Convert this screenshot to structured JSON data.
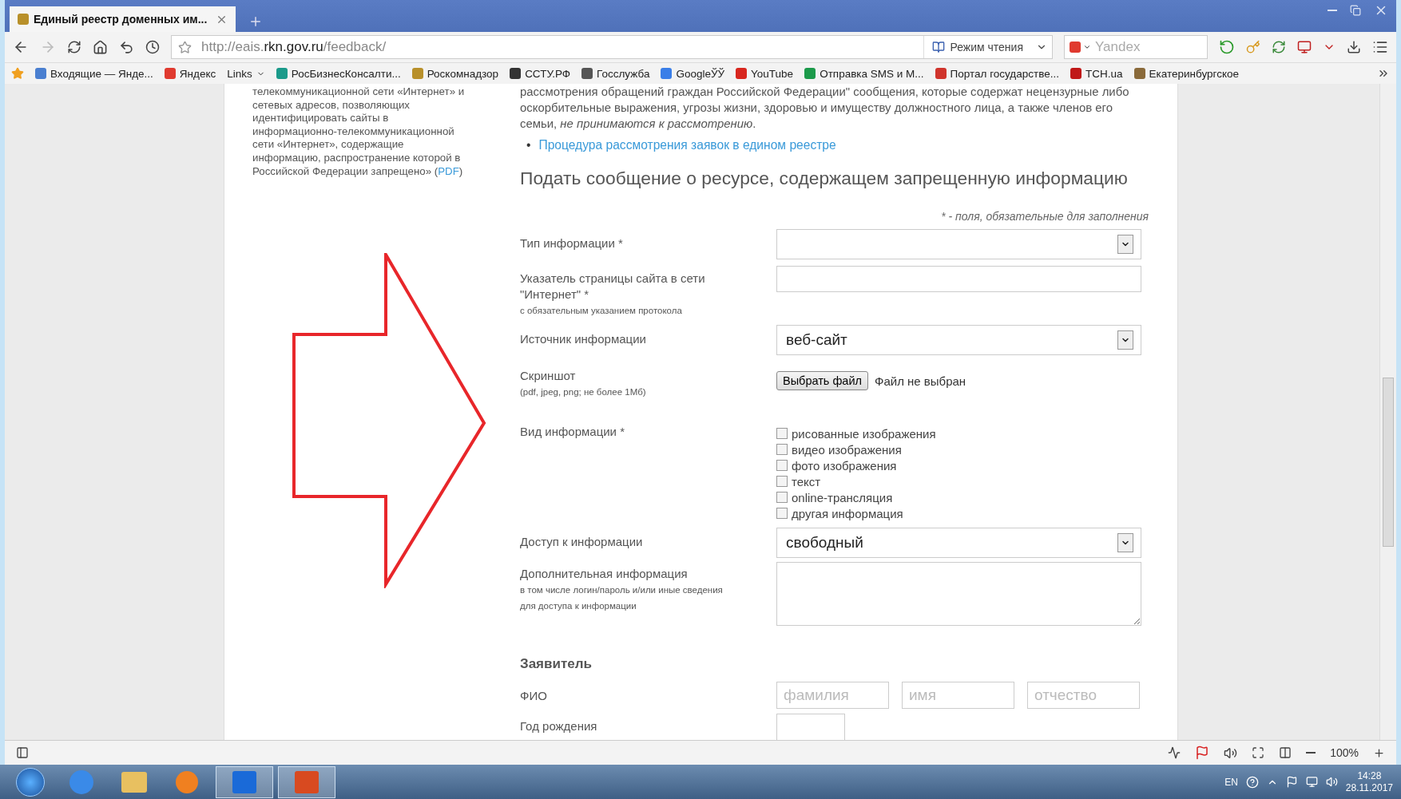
{
  "browser": {
    "tab_title": "Единый реестр доменных им...",
    "url_host_prefix": "http://eais.",
    "url_host": "rkn.gov.ru",
    "url_path": "/feedback/",
    "reader_mode": "Режим чтения",
    "search_placeholder": "Yandex",
    "bookmarks": [
      {
        "label": "Входящие — Янде...",
        "color": "#4a7fd0"
      },
      {
        "label": "Яндекс",
        "color": "#e03a2f"
      },
      {
        "label": "Links"
      },
      {
        "label": "РосБизнесКонсалти...",
        "color": "#1a9a8a"
      },
      {
        "label": "Роскомнадзор",
        "color": "#b8902a"
      },
      {
        "label": "ССТУ.РФ",
        "color": "#333333"
      },
      {
        "label": "Госслужба",
        "color": "#555555"
      },
      {
        "label": "GoogleЎЎ",
        "color": "#3a7ee8"
      },
      {
        "label": "YouTube",
        "color": "#d8261e"
      },
      {
        "label": "Отправка SMS и М...",
        "color": "#1b9a4a"
      },
      {
        "label": "Портал государстве...",
        "color": "#d0342c"
      },
      {
        "label": "TCH.ua",
        "color": "#c01818"
      },
      {
        "label": "Екатеринбургское",
        "color": "#8a6a3a"
      }
    ],
    "zoom": "100%"
  },
  "page": {
    "sidebar_text": "телекоммуникационной сети «Интернет» и сетевых адресов, позволяющих идентифицировать сайты в информационно-телекоммуникационной сети «Интернет», содержащие информацию, распространение которой в Российской Федерации запрещено» (",
    "sidebar_link": "PDF",
    "sidebar_tail": ")",
    "intro": "рассмотрения обращений граждан Российской Федерации\" сообщения, которые содержат нецензурные либо оскорбительные выражения, угрозы жизни, здоровью и имуществу должностного лица, а также членов его семьи, *не принимаются к рассмотрению*.",
    "bullet": "•",
    "link": "Процедура рассмотрения заявок в едином реестре",
    "heading": "Подать сообщение о ресурсе, содержащем запрещенную информацию",
    "required_note": "* - поля, обязательные для заполнения",
    "fields": [
      {
        "kind": "select",
        "label": "Тип информации *"
      },
      {
        "kind": "text",
        "label": "Указатель страницы сайта в сети \"Интернет\" *",
        "hint": "с обязательным указанием протокола"
      },
      {
        "kind": "select",
        "label": "Источник информации",
        "value": "веб-сайт"
      },
      {
        "kind": "file",
        "label": "Скриншот",
        "hint": "(pdf, jpeg, png; не более 1Мб)",
        "button": "Выбрать файл",
        "status": "Файл не выбран"
      },
      {
        "kind": "checkboxes",
        "label": "Вид информации *",
        "options": [
          {
            "label": "рисованные изображения",
            "checked": false
          },
          {
            "label": "видео изображения",
            "checked": false
          },
          {
            "label": "фото изображения",
            "checked": false
          },
          {
            "label": "текст",
            "checked": false
          },
          {
            "label": "online-трансляция",
            "checked": false
          },
          {
            "label": "другая информация",
            "checked": false
          }
        ]
      },
      {
        "kind": "select",
        "label": "Доступ к информации",
        "value": "свободный"
      },
      {
        "kind": "textarea",
        "label": "Дополнительная информация",
        "hint": "в том числе логин/пароль и/или иные сведения для доступа к информации"
      }
    ],
    "applicant": {
      "heading": "Заявитель",
      "name_label": "ФИО",
      "name_placeholders": [
        "фамилия",
        "имя",
        "отчество"
      ],
      "birth_label": "Год рождения"
    }
  },
  "taskbar": {
    "lang": "EN",
    "time": "14:28",
    "date": "28.11.2017"
  }
}
